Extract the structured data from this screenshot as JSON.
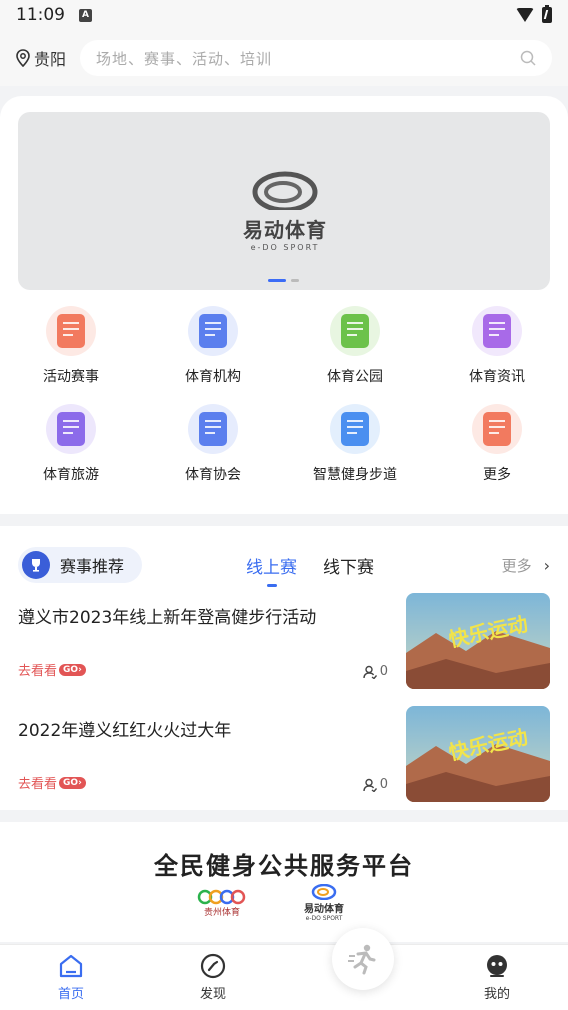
{
  "status": {
    "time": "11:09",
    "badge": "A"
  },
  "top": {
    "location": "贵阳",
    "search_placeholder": "场地、赛事、活动、培训"
  },
  "banner": {
    "logo_cn": "易动体育",
    "logo_en": "e-DO SPORT"
  },
  "grid": [
    {
      "label": "活动赛事",
      "icon": "event-icon",
      "color": "#f27a5f",
      "bg": "#fde9e4"
    },
    {
      "label": "体育机构",
      "icon": "org-icon",
      "color": "#5b7fee",
      "bg": "#e6ecfd"
    },
    {
      "label": "体育公园",
      "icon": "park-icon",
      "color": "#6cc24a",
      "bg": "#e8f6e1"
    },
    {
      "label": "体育资讯",
      "icon": "news-icon",
      "color": "#a86ae8",
      "bg": "#f1e8fc"
    },
    {
      "label": "体育旅游",
      "icon": "travel-icon",
      "color": "#8c6bea",
      "bg": "#ede7fc"
    },
    {
      "label": "体育协会",
      "icon": "association-icon",
      "color": "#5b7fee",
      "bg": "#e6ecfd"
    },
    {
      "label": "智慧健身步道",
      "icon": "walkway-icon",
      "color": "#4a8ff0",
      "bg": "#e3effd"
    },
    {
      "label": "更多",
      "icon": "more-icon",
      "color": "#f27a5f",
      "bg": "#fde9e4"
    }
  ],
  "events": {
    "section_label": "赛事推荐",
    "tabs": [
      "线上赛",
      "线下赛"
    ],
    "more": "更多",
    "items": [
      {
        "title": "遵义市2023年线上新年登高健步行活动",
        "go": "去看看",
        "go_badge": "GO",
        "count": "0"
      },
      {
        "title": "2022年遵义红红火火过大年",
        "go": "去看看",
        "go_badge": "GO",
        "count": "0"
      }
    ]
  },
  "platform": {
    "title": "全民健身公共服务平台",
    "logo1": "贵州体育",
    "logo2": "易动体育",
    "logo2_en": "e-DO SPORT"
  },
  "tabbar": [
    {
      "label": "首页",
      "icon": "home-icon",
      "active": true
    },
    {
      "label": "发现",
      "icon": "discover-icon",
      "active": false
    },
    {
      "label": "我的",
      "icon": "profile-icon",
      "active": false
    }
  ],
  "colors": {
    "accent": "#3a6df0",
    "go": "#e25555"
  }
}
